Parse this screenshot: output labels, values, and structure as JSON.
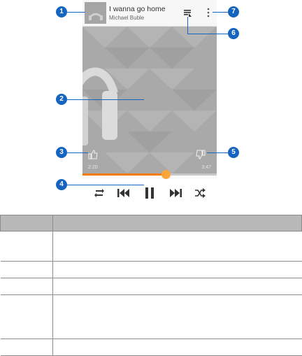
{
  "player": {
    "song_title": "I wanna go home",
    "artist": "Michael Buble",
    "elapsed_time": "2:20",
    "total_time": "3:47",
    "progress_fraction": 0.62
  },
  "callouts": [
    "1",
    "2",
    "3",
    "4",
    "5",
    "6",
    "7"
  ],
  "table": {
    "headers": [
      "",
      ""
    ],
    "rows": [
      [
        "",
        ""
      ],
      [
        "",
        ""
      ],
      [
        "",
        ""
      ],
      [
        "",
        ""
      ],
      [
        "",
        ""
      ]
    ]
  },
  "colors": {
    "accent": "#f57c00",
    "callout": "#1565c0"
  },
  "icons": [
    "album-thumbnail",
    "queue-icon",
    "more-menu-icon",
    "thumb-up-icon",
    "thumb-down-icon",
    "repeat-icon",
    "previous-icon",
    "pause-icon",
    "next-icon",
    "shuffle-icon"
  ]
}
